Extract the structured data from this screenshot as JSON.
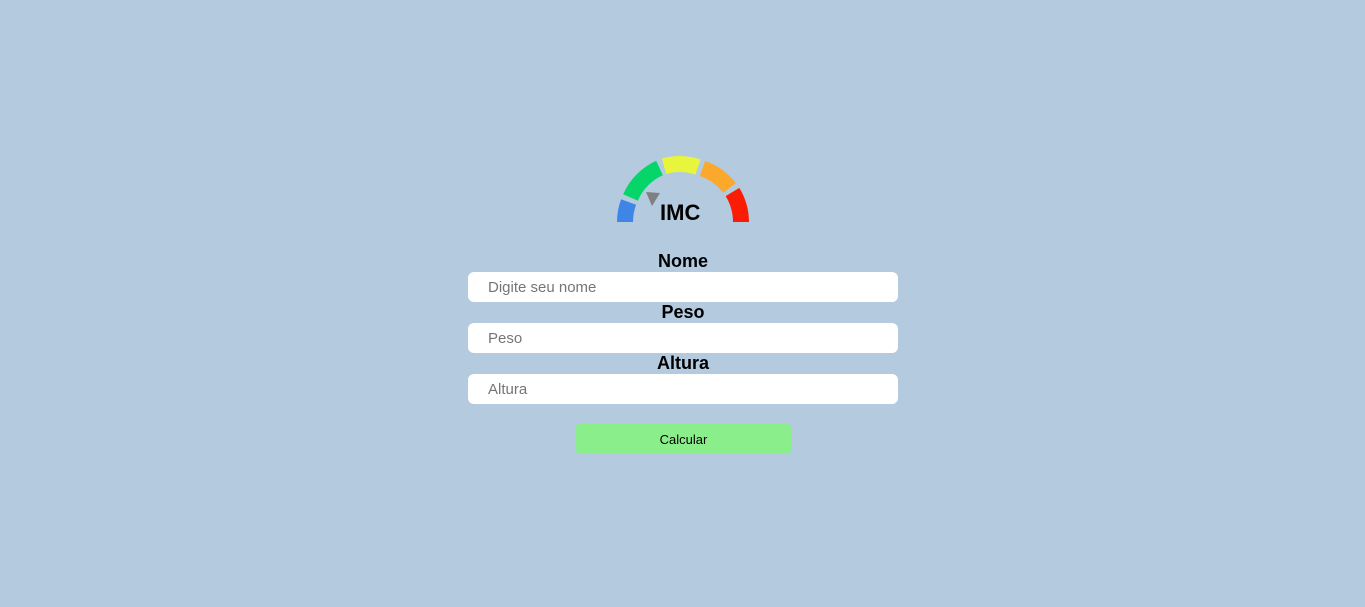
{
  "logo": {
    "title": "IMC",
    "gauge_colors": [
      "#3f85e6",
      "#06d66a",
      "#e8f53d",
      "#fba92d",
      "#fb1c06"
    ],
    "needle_color": "#808080"
  },
  "form": {
    "nome": {
      "label": "Nome",
      "placeholder": "Digite seu nome",
      "value": ""
    },
    "peso": {
      "label": "Peso",
      "placeholder": "Peso",
      "value": ""
    },
    "altura": {
      "label": "Altura",
      "placeholder": "Altura",
      "value": ""
    }
  },
  "button": {
    "label": "Calcular",
    "color": "#8aee8a"
  },
  "background_color": "#b4cadf"
}
